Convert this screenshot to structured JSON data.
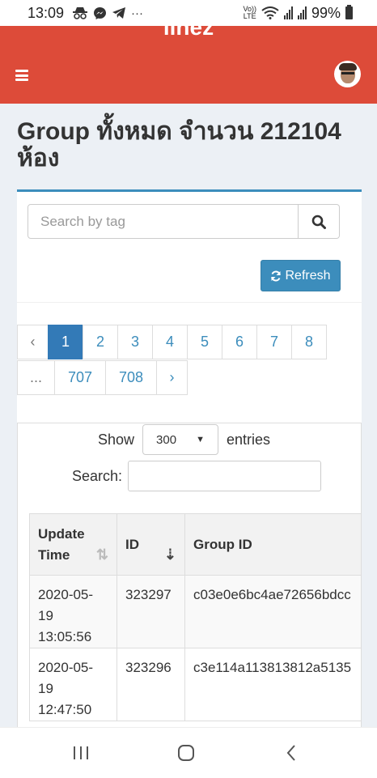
{
  "status_bar": {
    "time": "13:09",
    "battery": "99%",
    "icons": [
      "incognito-icon",
      "messenger-icon",
      "telegram-icon",
      "more-icon",
      "volte-icon",
      "wifi-icon",
      "signal-icon",
      "signal-icon",
      "battery-icon"
    ],
    "more": "···",
    "volte_top": "Vo))",
    "volte_bottom": "LTE"
  },
  "header": {
    "logo_text": "linez",
    "color": "#dd4b39"
  },
  "page": {
    "title": "Group ทั้งหมด จำนวน 212104 ห้อง"
  },
  "search": {
    "placeholder": "Search by tag",
    "value": ""
  },
  "refresh": {
    "label": "Refresh"
  },
  "pagination": {
    "prev": "‹",
    "row1": [
      "1",
      "2",
      "3",
      "4",
      "5",
      "6",
      "7",
      "8"
    ],
    "ellipsis": "...",
    "row2": [
      "707",
      "708"
    ],
    "next": "›",
    "active": "1"
  },
  "datatable": {
    "show_label": "Show",
    "length_value": "300",
    "entries_label": "entries",
    "search_label": "Search:",
    "columns": [
      {
        "line1": "Update",
        "line2": "Time"
      },
      {
        "line1": "ID",
        "line2": ""
      },
      {
        "line1": "Group ID",
        "line2": ""
      }
    ],
    "rows": [
      {
        "date": "2020-05-",
        "date2": "19",
        "time": "13:05:56",
        "id": "323297",
        "group_id": "c03e0e6bc4ae72656bdcc"
      },
      {
        "date": "2020-05-",
        "date2": "19",
        "time": "12:47:50",
        "id": "323296",
        "group_id": "c3e114a113813812a5135"
      }
    ]
  },
  "colors": {
    "accent": "#3c8dbc",
    "active_page": "#337ab7",
    "background": "#ecf0f5"
  }
}
